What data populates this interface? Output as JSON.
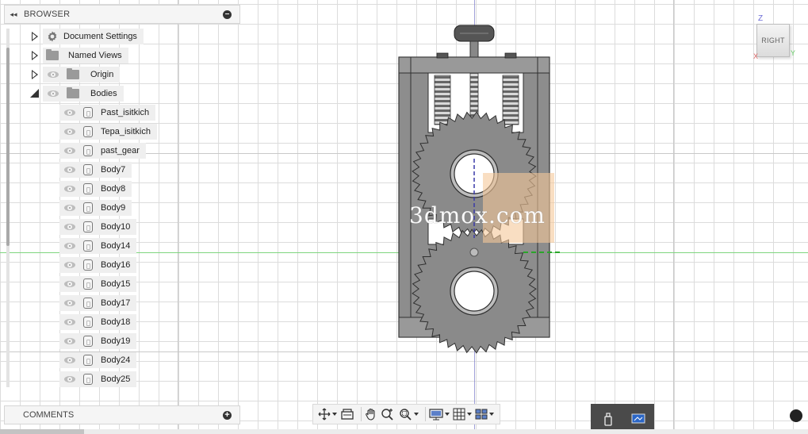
{
  "browser": {
    "title": "BROWSER",
    "items": [
      {
        "label": "Document Settings",
        "kind": "settings"
      },
      {
        "label": "Named Views",
        "kind": "folder"
      },
      {
        "label": "Origin",
        "kind": "folder"
      },
      {
        "label": "Bodies",
        "kind": "folder",
        "expanded": true
      }
    ],
    "bodies": [
      "Past_isitkich",
      "Tepa_isitkich",
      "past_gear",
      "Body7",
      "Body8",
      "Body9",
      "Body10",
      "Body14",
      "Body16",
      "Body15",
      "Body17",
      "Body18",
      "Body19",
      "Body24",
      "Body25"
    ]
  },
  "comments": {
    "title": "COMMENTS"
  },
  "viewcube": {
    "face": "RIGHT",
    "z": "Z",
    "x": "X",
    "y": "Y"
  },
  "watermark": "3dmox.com",
  "toolbar": {
    "icons": [
      "orbit-icon",
      "look-at-icon",
      "pan-icon",
      "zoom-icon",
      "fit-icon",
      "display-settings-icon",
      "grid-icon",
      "viewports-icon"
    ]
  },
  "colors": {
    "model_fill": "#8a8a8a",
    "model_stroke": "#2f2f2f",
    "axis_green": "#7fd67f",
    "axis_blue": "#8a8ad0",
    "tray": "#4a4a4a"
  }
}
